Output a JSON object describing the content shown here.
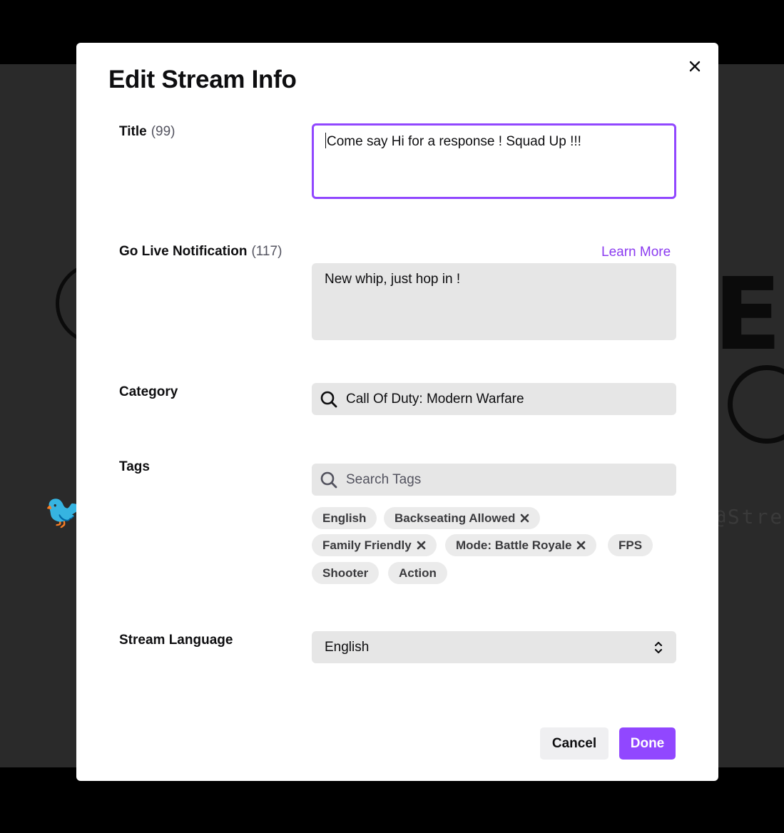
{
  "background": {
    "big_letter": "E",
    "handle": "@Stre"
  },
  "modal": {
    "title": "Edit Stream Info",
    "close_icon": "close-icon",
    "title_field": {
      "label": "Title",
      "count": "(99)",
      "value": "Come say Hi for a response ! Squad Up !!!"
    },
    "notification_field": {
      "label": "Go Live Notification",
      "count": "(117)",
      "learn_more": "Learn More",
      "value": "New whip, just hop in !"
    },
    "category_field": {
      "label": "Category",
      "value": "Call Of Duty: Modern Warfare",
      "icon": "search-icon"
    },
    "tags_field": {
      "label": "Tags",
      "placeholder": "Search Tags",
      "icon": "search-icon",
      "tags": [
        {
          "label": "English",
          "removable": false
        },
        {
          "label": "Backseating Allowed",
          "removable": true
        },
        {
          "label": "Family Friendly",
          "removable": true
        },
        {
          "label": "Mode: Battle Royale",
          "removable": true
        },
        {
          "label": "FPS",
          "removable": false
        },
        {
          "label": "Shooter",
          "removable": false
        },
        {
          "label": "Action",
          "removable": false
        }
      ]
    },
    "language_field": {
      "label": "Stream Language",
      "value": "English"
    },
    "buttons": {
      "cancel": "Cancel",
      "done": "Done"
    }
  },
  "colors": {
    "accent": "#9147ff",
    "link": "#8b3bf0",
    "field_bg": "#e6e6e6",
    "tag_bg": "#ebebeb"
  }
}
